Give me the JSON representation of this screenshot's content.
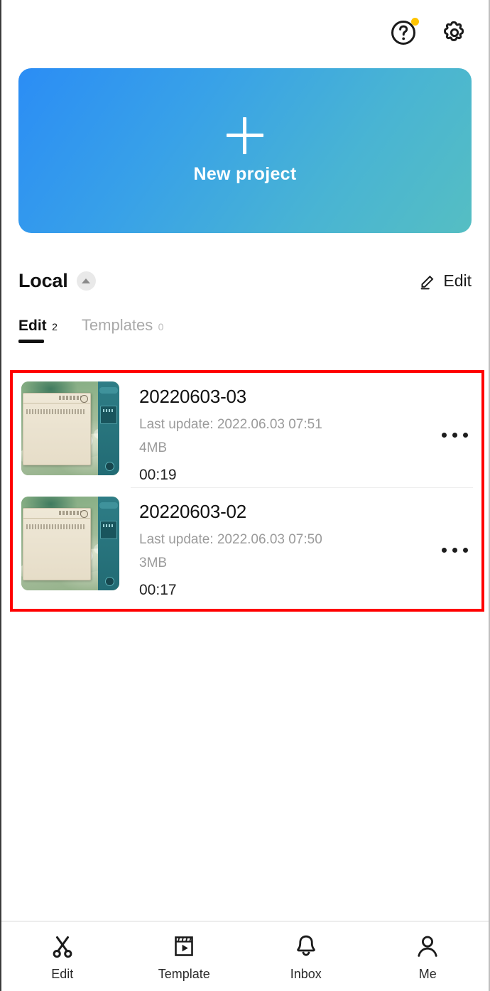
{
  "topbar": {
    "help_icon": "question-circle-icon",
    "help_badge": "notification-dot",
    "settings_icon": "gear-icon",
    "badge_color": "#FFC400"
  },
  "banner": {
    "plus_icon": "plus-icon",
    "label": "New project",
    "gradient_start": "#2B8DF5",
    "gradient_end": "#55BEC3"
  },
  "section": {
    "title": "Local",
    "collapse_icon": "chevron-up-icon",
    "edit_icon": "pencil-icon",
    "edit_label": "Edit"
  },
  "tabs": [
    {
      "label": "Edit",
      "count": "2",
      "active": true
    },
    {
      "label": "Templates",
      "count": "0",
      "active": false
    }
  ],
  "highlight": {
    "color": "#FF0000"
  },
  "projects": [
    {
      "name": "20220603-03",
      "last_update": "Last update: 2022.06.03 07:51",
      "size": "4MB",
      "duration": "00:19",
      "menu_icon": "more-horizontal-icon",
      "thumbnail": "game-screenshot-thumbnail"
    },
    {
      "name": "20220603-02",
      "last_update": "Last update: 2022.06.03 07:50",
      "size": "3MB",
      "duration": "00:17",
      "menu_icon": "more-horizontal-icon",
      "thumbnail": "game-screenshot-thumbnail"
    }
  ],
  "bottom_nav": [
    {
      "label": "Edit",
      "icon": "scissors-icon",
      "active": true
    },
    {
      "label": "Template",
      "icon": "clapperboard-play-icon",
      "active": false
    },
    {
      "label": "Inbox",
      "icon": "bell-icon",
      "active": false
    },
    {
      "label": "Me",
      "icon": "person-icon",
      "active": false
    }
  ]
}
